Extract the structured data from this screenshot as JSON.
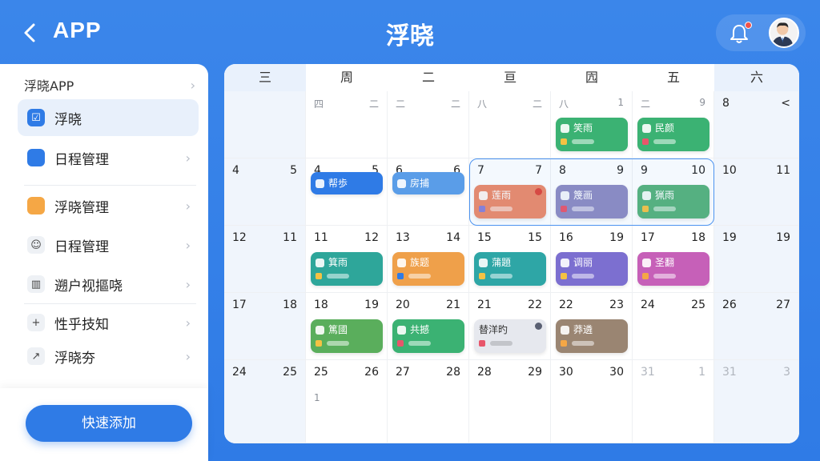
{
  "header": {
    "back_label": "APP",
    "title": "浮晓"
  },
  "sidebar": {
    "heading": "浮晓APP",
    "items": [
      {
        "label": "浮晓",
        "icon": "checklist-icon",
        "color": "#2f7be6",
        "active": true
      },
      {
        "label": "日程管理",
        "icon": "folder-icon",
        "color": "#2f7be6"
      },
      {
        "label": "浮晓管理",
        "icon": "folder-icon",
        "color": "#f5a745"
      },
      {
        "label": "日程管理",
        "icon": "robot-icon",
        "color": "#555"
      },
      {
        "label": "遡户视摳哓",
        "icon": "bar-chart-icon",
        "color": "#555"
      },
      {
        "label": "性乎技知",
        "icon": "plus-icon",
        "color": "#555"
      },
      {
        "label": "浮晓夯",
        "icon": "share-icon",
        "color": "#555"
      }
    ],
    "quick_add": "快速添加"
  },
  "calendar": {
    "weekdays": [
      "三",
      "周",
      "二",
      "亘",
      "囥",
      "五",
      "六"
    ],
    "rows": [
      {
        "cells": [
          {
            "l": "",
            "r": "",
            "shade": true
          },
          {
            "l": "四",
            "r": "二",
            "small": true
          },
          {
            "l": "二",
            "r": "二",
            "small": true
          },
          {
            "l": "八",
            "r": "二",
            "small": true
          },
          {
            "l": "八",
            "r": "1",
            "small": true
          },
          {
            "l": "二",
            "r": "9",
            "small": true
          },
          {
            "l": "8",
            "r": "<",
            "shade": true
          }
        ]
      },
      {
        "cells": [
          {
            "l": "4",
            "r": "5",
            "shade": true
          },
          {
            "l": "4",
            "r": "5"
          },
          {
            "l": "6",
            "r": "6"
          },
          {
            "l": "7",
            "r": "7"
          },
          {
            "l": "8",
            "r": "9"
          },
          {
            "l": "9",
            "r": "10"
          },
          {
            "l": "10",
            "r": "11",
            "shade": true
          }
        ]
      },
      {
        "cells": [
          {
            "l": "12",
            "r": "11",
            "shade": true
          },
          {
            "l": "11",
            "r": "12"
          },
          {
            "l": "13",
            "r": "14"
          },
          {
            "l": "15",
            "r": "15"
          },
          {
            "l": "16",
            "r": "19"
          },
          {
            "l": "17",
            "r": "18"
          },
          {
            "l": "19",
            "r": "19",
            "shade": true
          }
        ]
      },
      {
        "cells": [
          {
            "l": "17",
            "r": "18",
            "shade": true
          },
          {
            "l": "18",
            "r": "19"
          },
          {
            "l": "20",
            "r": "21"
          },
          {
            "l": "21",
            "r": "22"
          },
          {
            "l": "22",
            "r": "23"
          },
          {
            "l": "24",
            "r": "25"
          },
          {
            "l": "26",
            "r": "27",
            "shade": true
          }
        ]
      },
      {
        "cells": [
          {
            "l": "24",
            "r": "25",
            "shade": true
          },
          {
            "l": "25",
            "r": "26",
            "extra": "1"
          },
          {
            "l": "27",
            "r": "28"
          },
          {
            "l": "28",
            "r": "29"
          },
          {
            "l": "30",
            "r": "30"
          },
          {
            "l": "31",
            "r": "1",
            "dim": true
          },
          {
            "l": "31",
            "r": "3",
            "dim": true,
            "shade": true
          }
        ]
      }
    ],
    "events": [
      {
        "row": 0,
        "col": 4,
        "label": "笑雨",
        "color": "#3bb273",
        "dot": "#f5c243",
        "kind": "big"
      },
      {
        "row": 0,
        "col": 5,
        "label": "民颜",
        "color": "#3bb273",
        "dot": "#e8566b",
        "kind": "big"
      },
      {
        "row": 1,
        "col": 1,
        "label": "帮歩",
        "color": "#2f7be6",
        "kind": "pill"
      },
      {
        "row": 1,
        "col": 2,
        "label": "房捕",
        "color": "#5a9de8",
        "kind": "pill"
      },
      {
        "row": 1,
        "col": 3,
        "label": "莲雨",
        "color": "#ec8a6a",
        "dot": "#8b7fd6",
        "kind": "big",
        "corner": "#e0463a"
      },
      {
        "row": 1,
        "col": 4,
        "label": "篾画",
        "color": "#8e8bc2",
        "dot": "#e8566b",
        "kind": "big"
      },
      {
        "row": 1,
        "col": 5,
        "label": "猟雨",
        "color": "#57b27b",
        "dot": "#f5c243",
        "kind": "big"
      },
      {
        "row": 2,
        "col": 1,
        "label": "箕雨",
        "color": "#2ea69a",
        "dot": "#f5c243",
        "kind": "big"
      },
      {
        "row": 2,
        "col": 2,
        "label": "族题",
        "color": "#efa04a",
        "dot": "#2f7be6",
        "kind": "big"
      },
      {
        "row": 2,
        "col": 3,
        "label": "蒲題",
        "color": "#2ea6a6",
        "dot": "#f5c243",
        "kind": "big"
      },
      {
        "row": 2,
        "col": 4,
        "label": "调丽",
        "color": "#7c6fd0",
        "dot": "#f5c243",
        "kind": "big"
      },
      {
        "row": 2,
        "col": 5,
        "label": "圣翻",
        "color": "#c660b8",
        "dot": "#f5a745",
        "kind": "big"
      },
      {
        "row": 3,
        "col": 1,
        "label": "篤國",
        "color": "#5aae5c",
        "dot": "#f5c243",
        "kind": "big"
      },
      {
        "row": 3,
        "col": 2,
        "label": "共撼",
        "color": "#3bb273",
        "dot": "#e8566b",
        "kind": "big"
      },
      {
        "row": 3,
        "col": 3,
        "label": "替洋旳",
        "color": "#e6e8ee",
        "dot": "#e8566b",
        "kind": "big",
        "light": true,
        "corner": "#5a6072"
      },
      {
        "row": 3,
        "col": 4,
        "label": "莽遴",
        "color": "#9a8572",
        "dot": "#f5a745",
        "kind": "big"
      }
    ]
  }
}
